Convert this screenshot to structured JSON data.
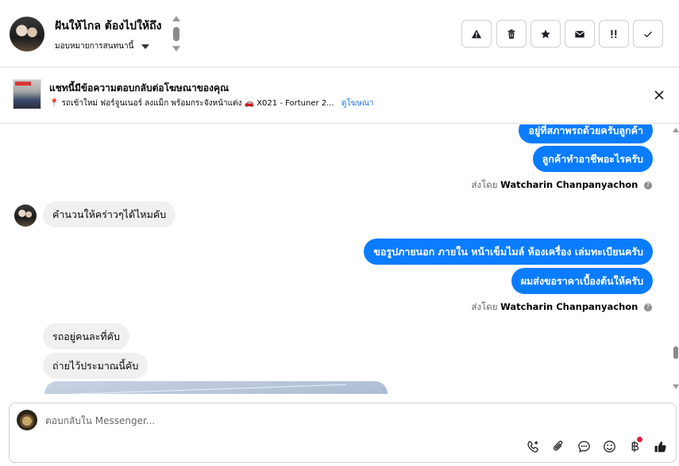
{
  "header": {
    "contact_name": "ฝันให้ไกล ต้องไปให้ถึง",
    "assign_label": "มอบหมายการสนทนานี้",
    "toolbar": [
      {
        "name": "spam-button",
        "icon": "warning-icon"
      },
      {
        "name": "delete-button",
        "icon": "trash-icon"
      },
      {
        "name": "star-button",
        "icon": "star-icon"
      },
      {
        "name": "mark-unread-button",
        "icon": "envelope-icon"
      },
      {
        "name": "follow-up-button",
        "icon": "exclamation-icon"
      },
      {
        "name": "mark-done-button",
        "icon": "check-icon"
      }
    ]
  },
  "ad_banner": {
    "title": "แชทนี้มีข้อความตอบกลับต่อโฆษณาของคุณ",
    "pin": "📍",
    "description": "รถเข้าใหม่ ฟอร์จูนเนอร์ ลงแม็ก พร้อมกระจังหน้าแต่ง 🚗 X021 - Fortuner 2...",
    "link_label": "ดูโฆษณา"
  },
  "chat": {
    "outgoing_1a": "อยู่ที่สภาพรถด้วยครับลูกค้า",
    "outgoing_1b": "ลูกค้าทำอาชีพอะไรครับ",
    "sent_by_label": "ส่งโดย",
    "agent_name": "Watcharin Chanpanyachon",
    "incoming_1": "คำนวนให้คร่าวๆได้ไหมคับ",
    "outgoing_2a": "ขอรูปภายนอก ภายใน หน้าเข็มไมล์ ห้องเครื่อง เล่มทะเบียนครับ",
    "outgoing_2b": "ผมส่งขอราคาเบื้องต้นให้ครับ",
    "incoming_2a": "รถอยู่คนละที่คับ",
    "incoming_2b": "ถ่ายไว้ประมาณนี้คับ"
  },
  "composer": {
    "placeholder": "ตอบกลับใน Messenger...",
    "icons": [
      "call-add-icon",
      "paperclip-icon",
      "saved-reply-icon",
      "emoji-icon",
      "baht-icon",
      "like-icon"
    ]
  },
  "colors": {
    "outgoing_bubble": "#0a7cff",
    "incoming_bubble": "#f0f0f0",
    "link": "#1b74e4",
    "notification_dot": "#e41e3f"
  }
}
